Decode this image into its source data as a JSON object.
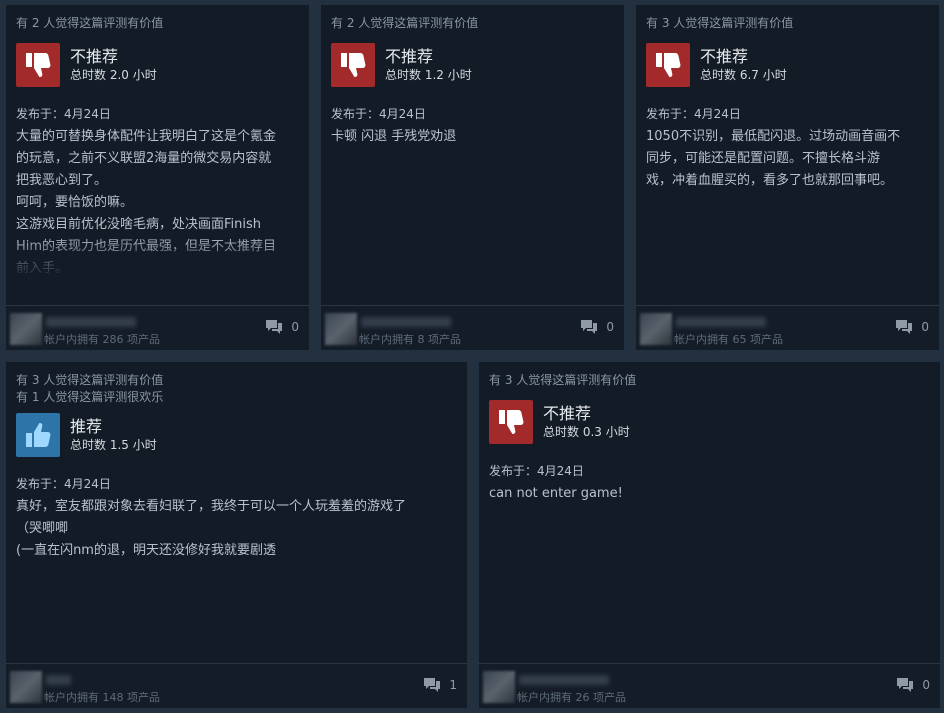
{
  "reviews": [
    {
      "helpful_lines": [
        "有 2 人觉得这篇评测有价值"
      ],
      "verdict": "不推荐",
      "recommended": false,
      "hours": "总时数 2.0 小时",
      "posted": "发布于：4月24日",
      "content": "大量的可替换身体配件让我明白了这是个氪金\n的玩意，之前不义联盟2海量的微交易内容就\n把我恶心到了。\n呵呵，要恰饭的嘛。\n这游戏目前优化没啥毛病，处决画面Finish\nHim的表现力也是历代最强，但是不太推荐目\n前入手。",
      "owned": "帐户内拥有 286 项产品",
      "comments": "0"
    },
    {
      "helpful_lines": [
        "有 2 人觉得这篇评测有价值"
      ],
      "verdict": "不推荐",
      "recommended": false,
      "hours": "总时数 1.2 小时",
      "posted": "发布于：4月24日",
      "content": "卡顿 闪退 手残党劝退",
      "owned": "帐户内拥有 8 项产品",
      "comments": "0"
    },
    {
      "helpful_lines": [
        "有 3 人觉得这篇评测有价值"
      ],
      "verdict": "不推荐",
      "recommended": false,
      "hours": "总时数 6.7 小时",
      "posted": "发布于：4月24日",
      "content": "1050不识别，最低配闪退。过场动画音画不\n同步，可能还是配置问题。不擅长格斗游\n戏，冲着血腥买的，看多了也就那回事吧。",
      "owned": "帐户内拥有 65 项产品",
      "comments": "0"
    },
    {
      "helpful_lines": [
        "有 3 人觉得这篇评测有价值",
        "有 1 人觉得这篇评测很欢乐"
      ],
      "verdict": "推荐",
      "recommended": true,
      "hours": "总时数 1.5 小时",
      "posted": "发布于：4月24日",
      "content": "真好，室友都跟对象去看妇联了，我终于可以一个人玩羞羞的游戏了\n（哭唧唧\n(一直在闪nm的退，明天还没修好我就要剧透",
      "owned": "帐户内拥有 148 项产品",
      "comments": "1"
    },
    {
      "helpful_lines": [
        "有 3 人觉得这篇评测有价值"
      ],
      "verdict": "不推荐",
      "recommended": false,
      "hours": "总时数 0.3 小时",
      "posted": "发布于：4月24日",
      "content": "can not enter game!",
      "owned": "帐户内拥有 26 项产品",
      "comments": "0"
    }
  ],
  "colors": {
    "not_recommended": "#a32a2a",
    "recommended": "#2d74a8"
  },
  "icons": {
    "not_recommended": "thumbs-down-icon",
    "recommended": "thumbs-up-icon",
    "comment": "comment-icon"
  }
}
